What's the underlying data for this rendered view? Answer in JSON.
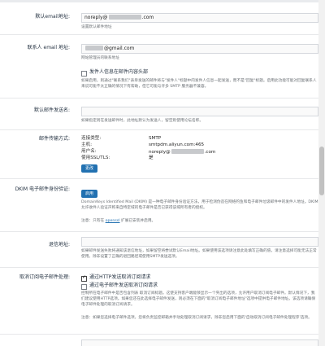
{
  "fields": {
    "default_email": {
      "label": "默认email地址:",
      "value_prefix": "noreply@",
      "value_suffix": ".com",
      "help": "设置默认邮件地址"
    },
    "contact_email": {
      "label": "联系人 email 地址:",
      "value_suffix": "@gmail.com",
      "help": "网站管理员的联系地址"
    },
    "sender_header": {
      "checkbox_label": "发件人信息在邮件内容头部",
      "help": "如果启用，则通过\"联系我们\"表单发送的邮件将与\"发件人\"标题中的发件人信息一起发送，而不是\"回复\"标题。启用此功能可能对回复联系人来说可能不太正确的情况下有帮助，但它可能与许多 SMTP 服务器不兼容。"
    },
    "sender_name": {
      "label": "默认邮件发送名:",
      "value": "",
      "help": "如果指定则在发送邮件时，此地址默认为发送人，留空则使用论坛名称。"
    },
    "transport": {
      "label": "邮件传输方式:",
      "rows": [
        {
          "key": "连接类型:",
          "value": "SMTP"
        },
        {
          "key": "主机:",
          "value": "smtpdm.aliyun.com:465"
        },
        {
          "key": "用户名:",
          "value_prefix": "noreply@",
          "value_suffix": ".com"
        },
        {
          "key": "使用SSL/TLS:",
          "value": "是"
        }
      ],
      "button": "更改"
    },
    "dkim": {
      "label": "DKIM 电子邮件身份验证:",
      "button": "启用",
      "help": "DomainKeys Identified Mail (DKIM) 是一种电子邮件身份验证方法，用于检测伪造在网络钓鱼和电子邮件垃圾邮件中的发件人地址。DKIM 允许收件人验证声称来自特定域的电子邮件是否已获得该域所有者的授权。",
      "note_prefix": "注意：只有在",
      "note_link": "openssl",
      "note_suffix": "扩展已安装并启用。"
    },
    "return_address": {
      "label": "退信地址:",
      "value": "",
      "help": "如果邮件发送失败将通知该退信地址，如果留空将尝试默认Email地址。如果使用该选项请注意此处填写正确的值，请注意选择可能无法正常使用。除非设置了正确的退回路径或使用SMTP发送选项。"
    },
    "unsubscribe": {
      "label": "取消订阅电子邮件处理:",
      "options": [
        {
          "label": "通过HTTP发送取消订阅请求",
          "checked": true
        },
        {
          "label": "通过电子邮件发送取消订阅请求",
          "checked": false
        }
      ],
      "help": "控制所在电子邮件中是否包含列表 取消订阅标题。这使支持客户端能够显示一个突出的选项，允许用户取消订阅电子邮件。默认情况下，我们建议使用HTTP选项。如果您还在此选择电子邮件发送，则必须在下面的\"取消订阅电子邮件地址\"选项中提供电子邮件地址。该选项请确保电子邮件处理的取消订阅请求。",
      "note": "注意：如果您选择电子邮件选项，您将负责监控邮箱并手动处理取消订阅请求，除非您启用下面的'自动取消订阅电子邮件处理程序'选项。"
    }
  }
}
